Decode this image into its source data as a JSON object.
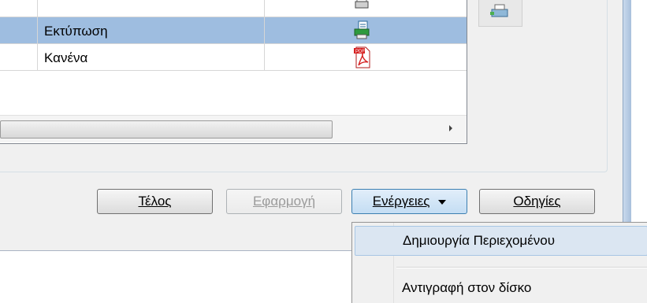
{
  "list": {
    "rows": [
      {
        "label": "",
        "icon": "document-icon",
        "selected": false
      },
      {
        "label": "Εκτύπωση",
        "icon": "printer-document-icon",
        "selected": true
      },
      {
        "label": "Κανένα",
        "icon": "pdf-icon",
        "selected": false
      }
    ]
  },
  "buttons": {
    "finish": "Τέλος",
    "apply": "Εφαρμογή",
    "actions": "Ενέργειες",
    "help": "Οδηγίες"
  },
  "menu": {
    "items": [
      {
        "label": "Δημιουργία Περιεχομένου"
      },
      {
        "label": "Αντιγραφή στον δίσκο"
      }
    ]
  },
  "colors": {
    "selection": "#9ebde0",
    "menu_highlight": "#dbe6f2",
    "pdf_red": "#d62020"
  }
}
